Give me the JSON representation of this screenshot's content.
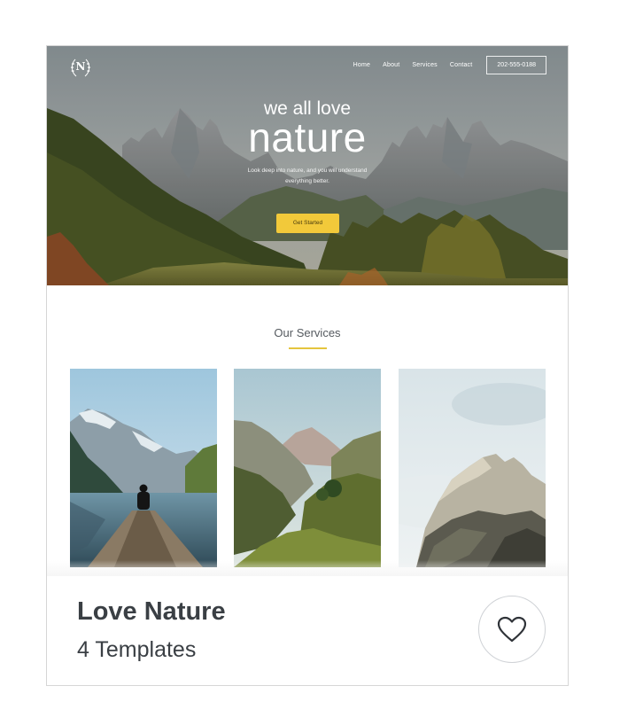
{
  "hero": {
    "logo_letter": "N",
    "nav": [
      {
        "label": "Home"
      },
      {
        "label": "About"
      },
      {
        "label": "Services"
      },
      {
        "label": "Contact"
      }
    ],
    "phone": "202-555-0188",
    "subtitle": "we all love",
    "title": "nature",
    "description": "Look deep into nature, and you will understand everything better.",
    "cta_label": "Get Started"
  },
  "services": {
    "title": "Our Services"
  },
  "template": {
    "name": "Love Nature",
    "count": "4 Templates"
  },
  "icons": {
    "logo": "laurel-wreath-icon",
    "favorite": "heart-icon"
  },
  "colors": {
    "accent": "#f2c93a",
    "text_dark": "#3a3f44",
    "card_border": "#d6d6d6"
  }
}
